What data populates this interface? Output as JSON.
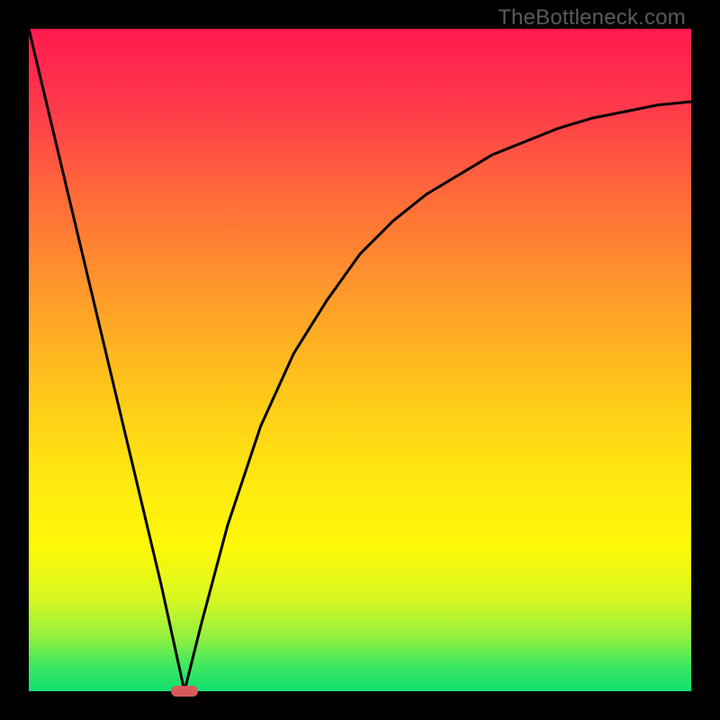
{
  "watermark": "TheBottleneck.com",
  "chart_data": {
    "type": "line",
    "title": "",
    "xlabel": "",
    "ylabel": "",
    "xlim": [
      0,
      100
    ],
    "ylim": [
      0,
      100
    ],
    "grid": false,
    "legend": false,
    "background_gradient": {
      "direction": "top-to-bottom",
      "stops": [
        {
          "pos": 0,
          "color": "#ff1a50"
        },
        {
          "pos": 25,
          "color": "#ff6a3a"
        },
        {
          "pos": 55,
          "color": "#ffc81a"
        },
        {
          "pos": 78,
          "color": "#fff808"
        },
        {
          "pos": 100,
          "color": "#10e070"
        }
      ]
    },
    "series": [
      {
        "name": "left-branch",
        "x": [
          0,
          5,
          10,
          15,
          20,
          23.5
        ],
        "values": [
          100,
          79,
          58,
          37,
          16,
          0
        ]
      },
      {
        "name": "right-branch",
        "x": [
          23.5,
          26,
          30,
          35,
          40,
          45,
          50,
          55,
          60,
          65,
          70,
          75,
          80,
          85,
          90,
          95,
          100
        ],
        "values": [
          0,
          10,
          25,
          40,
          51,
          59,
          66,
          71,
          75,
          78,
          81,
          83,
          85,
          86.5,
          87.5,
          88.5,
          89
        ]
      }
    ],
    "marker": {
      "x": 23.5,
      "y": 0,
      "w": 4,
      "h": 1.5,
      "color": "#da5a5a"
    }
  }
}
